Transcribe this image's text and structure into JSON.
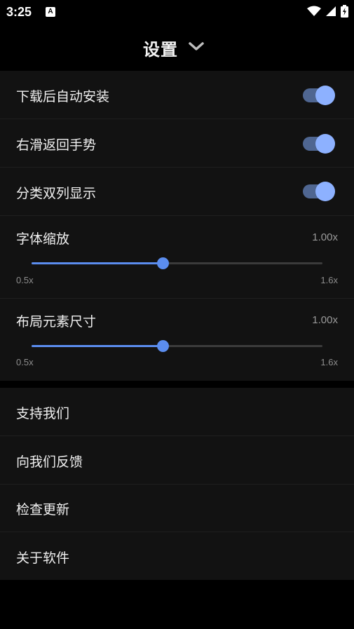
{
  "status_bar": {
    "time": "3:25",
    "notification_letter": "A"
  },
  "header": {
    "title": "设置"
  },
  "toggles": [
    {
      "label": "下载后自动安装",
      "on": true
    },
    {
      "label": "右滑返回手势",
      "on": true
    },
    {
      "label": "分类双列显示",
      "on": true
    }
  ],
  "sliders": [
    {
      "label": "字体缩放",
      "value_text": "1.00x",
      "min_text": "0.5x",
      "max_text": "1.6x",
      "fraction": 0.45
    },
    {
      "label": "布局元素尺寸",
      "value_text": "1.00x",
      "min_text": "0.5x",
      "max_text": "1.6x",
      "fraction": 0.45
    }
  ],
  "menu": [
    {
      "label": "支持我们"
    },
    {
      "label": "向我们反馈"
    },
    {
      "label": "检查更新"
    },
    {
      "label": "关于软件"
    }
  ],
  "colors": {
    "accent": "#5b8def",
    "toggle_thumb": "#8db1ff",
    "toggle_track": "#4f6691",
    "card_bg": "#121212",
    "page_bg": "#000000"
  }
}
